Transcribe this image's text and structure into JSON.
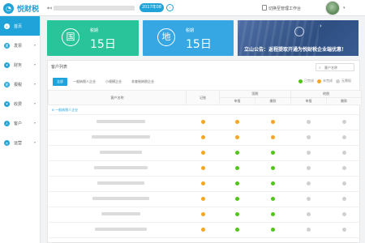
{
  "app": {
    "logo_text": "悦财税"
  },
  "topbar": {
    "period": "2017年08",
    "next": "›",
    "user_label": "切换至管理工作台",
    "back": "↤",
    "caret": "▾"
  },
  "sidebar": {
    "items": [
      {
        "label": "首页",
        "icon": "home-icon",
        "glyph": "⌂",
        "active": true
      },
      {
        "label": "发票",
        "icon": "invoice-icon",
        "glyph": "票"
      },
      {
        "label": "财务",
        "icon": "finance-icon",
        "glyph": "¥"
      },
      {
        "label": "报税",
        "icon": "tax-icon",
        "glyph": "税"
      },
      {
        "label": "收费",
        "icon": "fee-icon",
        "glyph": "¥"
      },
      {
        "label": "客户",
        "icon": "customer-icon",
        "glyph": "人"
      },
      {
        "label": "运营",
        "icon": "operations-icon",
        "glyph": "◎"
      }
    ]
  },
  "cards": {
    "national": {
      "badge": "国",
      "label": "税期",
      "value": "15日"
    },
    "local": {
      "badge": "地",
      "label": "税期",
      "value": "15日"
    },
    "banner": {
      "text": "立山公告：返程提取开通为悦财税企业端优惠！"
    }
  },
  "panel": {
    "title": "客户列表",
    "search_placeholder": "客户名称",
    "tabs": [
      "全部",
      "一般纳税人企业",
      "小规模企业",
      "非查账纳税企业"
    ],
    "legend": [
      {
        "label": "已完成",
        "color": "#52c41a"
      },
      {
        "label": "未完成",
        "color": "#f5a623"
      },
      {
        "label": "无需报",
        "color": "#d0d0d0"
      }
    ],
    "headers": {
      "name": "客户名称",
      "bookkeeping": "记账",
      "national_tax": "国税",
      "local_tax": "地税",
      "declare": "申报",
      "payment": "缴款"
    },
    "group_label": "一般纳税人企业",
    "rows": [
      {
        "name": "",
        "status": [
          "warn",
          "warn",
          "warn",
          "none",
          "none"
        ]
      },
      {
        "name": "",
        "status": [
          "warn",
          "warn",
          "warn",
          "none",
          "none"
        ]
      },
      {
        "name": "",
        "status": [
          "warn",
          "done",
          "done",
          "none",
          "none"
        ]
      },
      {
        "name": "",
        "status": [
          "warn",
          "done",
          "done",
          "none",
          "none"
        ]
      },
      {
        "name": "",
        "status": [
          "warn",
          "done",
          "done",
          "none",
          "none"
        ]
      },
      {
        "name": "",
        "status": [
          "warn",
          "done",
          "done",
          "none",
          "none"
        ]
      },
      {
        "name": "",
        "status": [
          "warn",
          "done",
          "done",
          "none",
          "none"
        ]
      },
      {
        "name": "",
        "status": [
          "warn",
          "done",
          "done",
          "none",
          "none"
        ]
      }
    ]
  },
  "colors": {
    "accent": "#1fa3d9",
    "national": "#2ac49b",
    "local": "#36a7e3"
  }
}
